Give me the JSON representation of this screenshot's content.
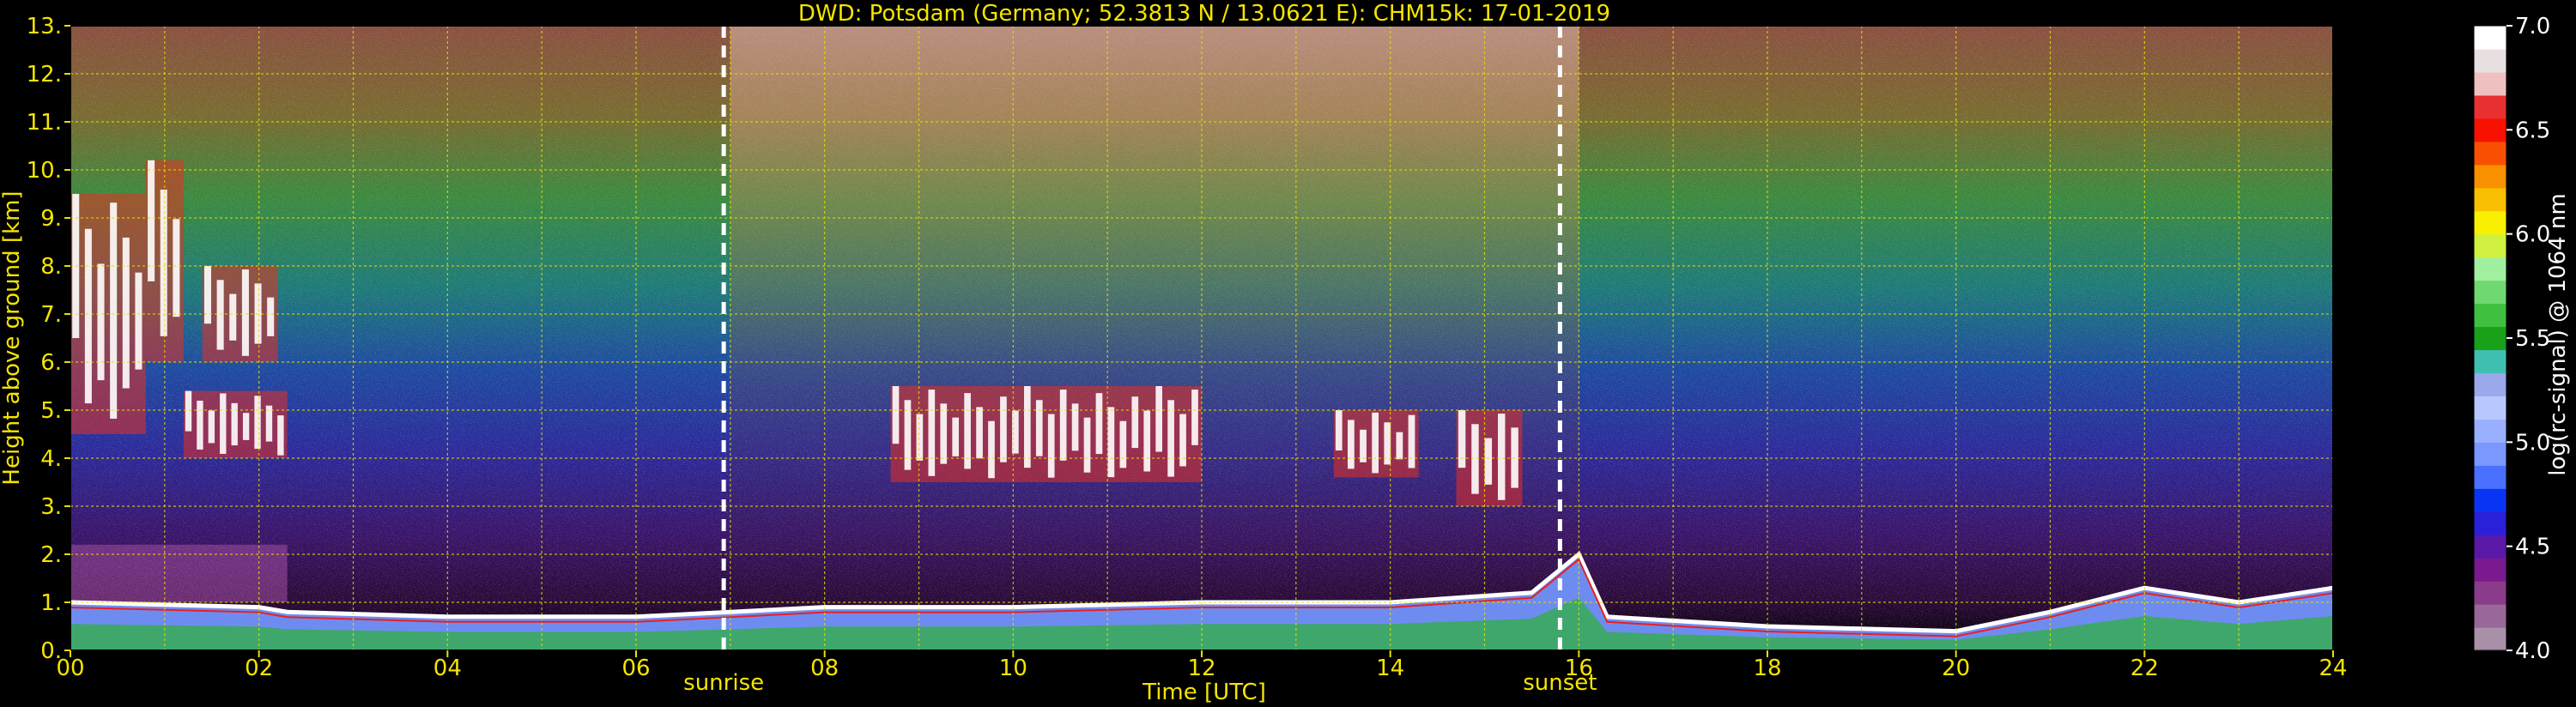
{
  "chart_data": {
    "type": "heatmap",
    "title": "DWD: Potsdam (Germany; 52.3813 N / 13.0621 E):    CHM15k: 17-01-2019",
    "xlabel": "Time [UTC]",
    "ylabel": "Height above ground [km]",
    "xlim": [
      0,
      24
    ],
    "ylim": [
      0,
      13
    ],
    "x_ticks": [
      "00",
      "02",
      "04",
      "06",
      "08",
      "10",
      "12",
      "14",
      "16",
      "18",
      "20",
      "22",
      "24"
    ],
    "y_ticks": [
      "0.",
      "1.",
      "2.",
      "3.",
      "4.",
      "5.",
      "6.",
      "7.",
      "8.",
      "9.",
      "10.",
      "11.",
      "12.",
      "13."
    ],
    "grid": true,
    "colorbar": {
      "label": "log(rc-signal) @ 1064 nm",
      "range": [
        4.0,
        7.0
      ],
      "ticks": [
        "4.0",
        "4.5",
        "5.0",
        "5.5",
        "6.0",
        "6.5",
        "7.0"
      ],
      "colors": [
        "#a890a8",
        "#986898",
        "#8a3c8a",
        "#7a1a8e",
        "#5a18a8",
        "#2a20d8",
        "#0a34f4",
        "#4a70ff",
        "#7a98ff",
        "#9ab0ff",
        "#b8c8ff",
        "#9aa8ec",
        "#40c0b0",
        "#18a018",
        "#40c040",
        "#70d870",
        "#a0f0a0",
        "#d0f040",
        "#f8f000",
        "#f8c000",
        "#f89000",
        "#f85000",
        "#f81000",
        "#e83030",
        "#f0c0c0",
        "#e8e0e0",
        "#ffffff"
      ]
    },
    "annotations": [
      {
        "label": "sunrise",
        "time_utc": 6.93
      },
      {
        "label": "sunset",
        "time_utc": 15.8
      }
    ],
    "boundary_layer_height_km": {
      "time_utc": [
        0,
        2,
        2.3,
        4,
        6,
        7,
        8,
        10,
        12,
        14,
        15.5,
        16,
        16.3,
        18,
        20,
        21,
        22,
        23,
        24
      ],
      "height_km": [
        1.0,
        0.9,
        0.8,
        0.7,
        0.7,
        0.8,
        0.9,
        0.9,
        1.0,
        1.0,
        1.2,
        2.0,
        0.7,
        0.5,
        0.4,
        0.8,
        1.3,
        1.0,
        1.3
      ]
    },
    "cloud_layers": [
      {
        "t0": 0.0,
        "t1": 0.8,
        "base_km": 4.5,
        "top_km": 9.5,
        "intensity": 6.8
      },
      {
        "t0": 0.8,
        "t1": 1.2,
        "base_km": 6.0,
        "top_km": 10.2,
        "intensity": 6.5
      },
      {
        "t0": 1.2,
        "t1": 2.3,
        "base_km": 4.0,
        "top_km": 5.4,
        "intensity": 6.9
      },
      {
        "t0": 1.4,
        "t1": 2.2,
        "base_km": 6.0,
        "top_km": 8.0,
        "intensity": 6.0
      },
      {
        "t0": 8.7,
        "t1": 12.0,
        "base_km": 3.5,
        "top_km": 5.5,
        "intensity": 6.6
      },
      {
        "t0": 13.4,
        "t1": 14.3,
        "base_km": 3.6,
        "top_km": 5.0,
        "intensity": 6.4
      },
      {
        "t0": 14.7,
        "t1": 15.4,
        "base_km": 3.0,
        "top_km": 5.0,
        "intensity": 6.2
      }
    ]
  }
}
